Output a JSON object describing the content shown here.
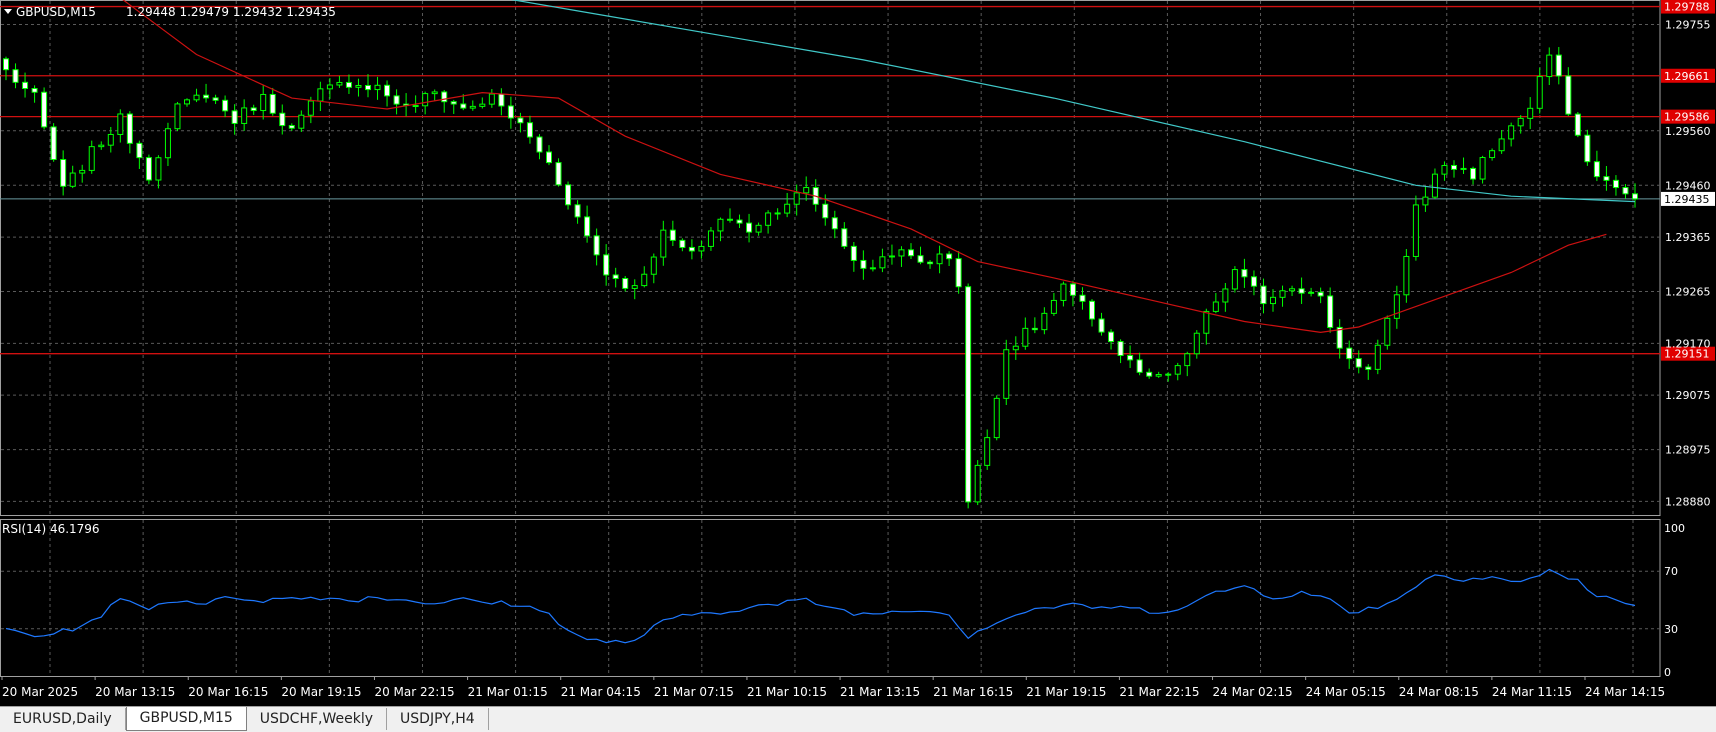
{
  "header": {
    "symbol_tf": "GBPUSD,M15",
    "ohlc": "1.29448 1.29479 1.29432 1.29435"
  },
  "colors": {
    "background": "#000000",
    "grid": "#5a5a5a",
    "candle": "#00ff00",
    "ma_fast": "#cc1111",
    "ma_slow": "#40c8c8",
    "rsi_line": "#1e78ff",
    "level_line": "#d01010",
    "axis_text": "#ffffff"
  },
  "chart_data": [
    {
      "type": "candlestick",
      "title": "GBPUSD,M15",
      "y_ticks": [
        1.29755,
        1.2956,
        1.2946,
        1.29365,
        1.29265,
        1.2917,
        1.29075,
        1.28975,
        1.2888
      ],
      "ylim": [
        1.28855,
        1.298
      ],
      "x_ticks": [
        "20 Mar 2025",
        "20 Mar 13:15",
        "20 Mar 16:15",
        "20 Mar 19:15",
        "20 Mar 22:15",
        "21 Mar 01:15",
        "21 Mar 04:15",
        "21 Mar 07:15",
        "21 Mar 10:15",
        "21 Mar 13:15",
        "21 Mar 16:15",
        "21 Mar 19:15",
        "21 Mar 22:15",
        "24 Mar 02:15",
        "24 Mar 05:15",
        "24 Mar 08:15",
        "24 Mar 11:15",
        "24 Mar 14:15"
      ],
      "levels": [
        {
          "label": "1.29788",
          "value": 1.29788
        },
        {
          "label": "1.29661",
          "value": 1.29661
        },
        {
          "label": "1.29586",
          "value": 1.29586
        },
        {
          "label": "1.29151",
          "value": 1.29151
        }
      ],
      "current_price": {
        "label": "1.29435",
        "value": 1.29435
      },
      "close_path": [
        [
          0,
          1.2967
        ],
        [
          3,
          1.2962
        ],
        [
          6,
          1.2945
        ],
        [
          9,
          1.2952
        ],
        [
          12,
          1.2958
        ],
        [
          15,
          1.2948
        ],
        [
          18,
          1.296
        ],
        [
          21,
          1.2963
        ],
        [
          24,
          1.2958
        ],
        [
          27,
          1.2962
        ],
        [
          30,
          1.2956
        ],
        [
          33,
          1.2963
        ],
        [
          36,
          1.2965
        ],
        [
          39,
          1.2964
        ],
        [
          42,
          1.296
        ],
        [
          45,
          1.2963
        ],
        [
          48,
          1.296
        ],
        [
          51,
          1.2962
        ],
        [
          54,
          1.2957
        ],
        [
          57,
          1.295
        ],
        [
          60,
          1.294
        ],
        [
          63,
          1.293
        ],
        [
          66,
          1.2927
        ],
        [
          69,
          1.2937
        ],
        [
          72,
          1.2933
        ],
        [
          75,
          1.294
        ],
        [
          78,
          1.2938
        ],
        [
          81,
          1.2942
        ],
        [
          84,
          1.2945
        ],
        [
          87,
          1.2938
        ],
        [
          90,
          1.293
        ],
        [
          93,
          1.2934
        ],
        [
          96,
          1.2932
        ],
        [
          99,
          1.2933
        ],
        [
          100,
          1.2928
        ],
        [
          101,
          1.2888
        ],
        [
          103,
          1.29
        ],
        [
          105,
          1.2916
        ],
        [
          108,
          1.292
        ],
        [
          111,
          1.2927
        ],
        [
          114,
          1.2922
        ],
        [
          117,
          1.2915
        ],
        [
          120,
          1.291
        ],
        [
          123,
          1.2912
        ],
        [
          126,
          1.2922
        ],
        [
          129,
          1.293
        ],
        [
          132,
          1.2925
        ],
        [
          135,
          1.2928
        ],
        [
          138,
          1.2925
        ],
        [
          140,
          1.2916
        ],
        [
          143,
          1.2912
        ],
        [
          146,
          1.2925
        ],
        [
          148,
          1.2942
        ],
        [
          151,
          1.295
        ],
        [
          154,
          1.2948
        ],
        [
          157,
          1.2955
        ],
        [
          160,
          1.296
        ],
        [
          162,
          1.297
        ],
        [
          164,
          1.296
        ],
        [
          166,
          1.295
        ],
        [
          169,
          1.2945
        ],
        [
          171,
          1.29435
        ]
      ],
      "ma_fast": [
        [
          0,
          1.299
        ],
        [
          10,
          1.2983
        ],
        [
          20,
          1.297
        ],
        [
          30,
          1.2962
        ],
        [
          40,
          1.296
        ],
        [
          50,
          1.2963
        ],
        [
          58,
          1.2962
        ],
        [
          65,
          1.2955
        ],
        [
          75,
          1.2948
        ],
        [
          85,
          1.2944
        ],
        [
          95,
          1.2938
        ],
        [
          102,
          1.2932
        ],
        [
          110,
          1.2929
        ],
        [
          120,
          1.2925
        ],
        [
          130,
          1.2921
        ],
        [
          138,
          1.2919
        ],
        [
          142,
          1.292
        ],
        [
          150,
          1.2925
        ],
        [
          158,
          1.293
        ],
        [
          164,
          1.2935
        ],
        [
          168,
          1.2937
        ]
      ],
      "ma_slow": [
        [
          0,
          1.2991
        ],
        [
          30,
          1.2987
        ],
        [
          60,
          1.2978
        ],
        [
          90,
          1.2969
        ],
        [
          110,
          1.2962
        ],
        [
          130,
          1.2954
        ],
        [
          148,
          1.2946
        ],
        [
          158,
          1.2944
        ],
        [
          171,
          1.2943
        ]
      ]
    },
    {
      "type": "line",
      "title": "RSI(14) 46.1796",
      "y_ticks": [
        100,
        70,
        30,
        0
      ],
      "ylim": [
        0,
        100
      ],
      "series": [
        {
          "name": "RSI(14)",
          "points": [
            [
              0,
              30
            ],
            [
              3,
              25
            ],
            [
              6,
              28
            ],
            [
              9,
              35
            ],
            [
              12,
              50
            ],
            [
              15,
              45
            ],
            [
              18,
              50
            ],
            [
              21,
              48
            ],
            [
              24,
              52
            ],
            [
              27,
              50
            ],
            [
              30,
              51
            ],
            [
              33,
              52
            ],
            [
              36,
              50
            ],
            [
              39,
              52
            ],
            [
              42,
              50
            ],
            [
              45,
              48
            ],
            [
              48,
              50
            ],
            [
              51,
              48
            ],
            [
              54,
              47
            ],
            [
              57,
              40
            ],
            [
              60,
              25
            ],
            [
              63,
              20
            ],
            [
              66,
              22
            ],
            [
              69,
              35
            ],
            [
              72,
              40
            ],
            [
              75,
              42
            ],
            [
              78,
              45
            ],
            [
              81,
              47
            ],
            [
              84,
              50
            ],
            [
              87,
              44
            ],
            [
              90,
              40
            ],
            [
              93,
              42
            ],
            [
              96,
              44
            ],
            [
              99,
              40
            ],
            [
              101,
              25
            ],
            [
              103,
              32
            ],
            [
              106,
              40
            ],
            [
              109,
              45
            ],
            [
              112,
              46
            ],
            [
              115,
              45
            ],
            [
              118,
              44
            ],
            [
              121,
              42
            ],
            [
              124,
              46
            ],
            [
              127,
              55
            ],
            [
              130,
              60
            ],
            [
              133,
              52
            ],
            [
              136,
              55
            ],
            [
              139,
              50
            ],
            [
              141,
              42
            ],
            [
              144,
              45
            ],
            [
              147,
              55
            ],
            [
              150,
              68
            ],
            [
              153,
              65
            ],
            [
              156,
              66
            ],
            [
              159,
              62
            ],
            [
              162,
              70
            ],
            [
              165,
              64
            ],
            [
              167,
              52
            ],
            [
              169,
              50
            ],
            [
              171,
              46.18
            ]
          ]
        }
      ]
    }
  ],
  "tabs": [
    {
      "label": "EURUSD,Daily",
      "active": false
    },
    {
      "label": "GBPUSD,M15",
      "active": true
    },
    {
      "label": "USDCHF,Weekly",
      "active": false
    },
    {
      "label": "USDJPY,H4",
      "active": false
    }
  ]
}
